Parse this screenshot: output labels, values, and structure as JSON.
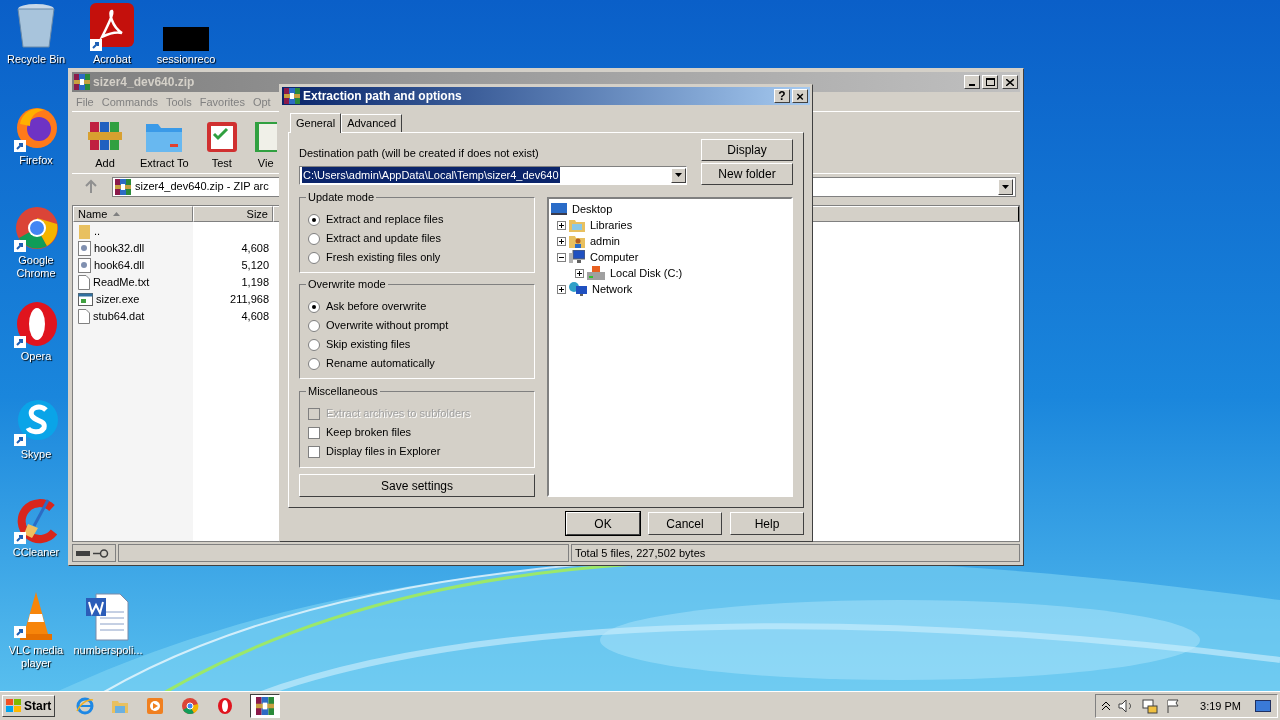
{
  "desktop_icons": [
    {
      "label": "Recycle Bin",
      "kind": "recycle"
    },
    {
      "label": "Acrobat",
      "kind": "acrobat"
    },
    {
      "label": "sessionreco",
      "kind": "redacted"
    },
    {
      "label": "Firefox",
      "kind": "firefox"
    },
    {
      "label": "Google Chrome",
      "kind": "chrome"
    },
    {
      "label": "Opera",
      "kind": "opera"
    },
    {
      "label": "Skype",
      "kind": "skype"
    },
    {
      "label": "CCleaner",
      "kind": "ccleaner"
    },
    {
      "label": "VLC media player",
      "kind": "vlc"
    },
    {
      "label": "numberspoli...",
      "kind": "word"
    }
  ],
  "archive_window": {
    "title": "sizer4_dev640.zip",
    "menu": [
      "File",
      "Commands",
      "Tools",
      "Favorites",
      "Opt"
    ],
    "toolbar": [
      {
        "label": "Add",
        "kind": "add"
      },
      {
        "label": "Extract To",
        "kind": "extract"
      },
      {
        "label": "Test",
        "kind": "test"
      },
      {
        "label": "Vie",
        "kind": "view"
      }
    ],
    "address": "sizer4_dev640.zip - ZIP arc",
    "columns": [
      "Name",
      "Size"
    ],
    "files": [
      {
        "name": "..",
        "kind": "folder"
      },
      {
        "name": "hook32.dll",
        "size": "4,608",
        "kind": "dll"
      },
      {
        "name": "hook64.dll",
        "size": "5,120",
        "kind": "dll"
      },
      {
        "name": "ReadMe.txt",
        "size": "1,198",
        "kind": "file"
      },
      {
        "name": "sizer.exe",
        "size": "211,968",
        "kind": "exe"
      },
      {
        "name": "stub64.dat",
        "size": "4,608",
        "kind": "file"
      }
    ],
    "status": "Total 5 files, 227,502 bytes"
  },
  "dialog": {
    "title": "Extraction path and options",
    "help_button": "?",
    "close_button": "×",
    "tabs": [
      {
        "label": "General",
        "selected": true
      },
      {
        "label": "Advanced",
        "selected": false
      }
    ],
    "destination_label": "Destination path (will be created if does not exist)",
    "destination_path": "C:\\Users\\admin\\AppData\\Local\\Temp\\sizer4_dev640",
    "side_buttons": [
      "Display",
      "New folder"
    ],
    "update_mode": {
      "title": "Update mode",
      "options": [
        {
          "label": "Extract and replace files",
          "selected": true
        },
        {
          "label": "Extract and update files",
          "selected": false
        },
        {
          "label": "Fresh existing files only",
          "selected": false
        }
      ]
    },
    "overwrite_mode": {
      "title": "Overwrite mode",
      "options": [
        {
          "label": "Ask before overwrite",
          "selected": true
        },
        {
          "label": "Overwrite without prompt",
          "selected": false
        },
        {
          "label": "Skip existing files",
          "selected": false
        },
        {
          "label": "Rename automatically",
          "selected": false
        }
      ]
    },
    "miscellaneous": {
      "title": "Miscellaneous",
      "options": [
        {
          "label": "Extract archives to subfolders",
          "checked": false,
          "disabled": true
        },
        {
          "label": "Keep broken files",
          "checked": false,
          "disabled": false
        },
        {
          "label": "Display files in Explorer",
          "checked": false,
          "disabled": false
        }
      ]
    },
    "save_button": "Save settings",
    "tree": [
      {
        "label": "Desktop",
        "kind": "desktop",
        "children": [
          {
            "label": "Libraries",
            "kind": "libraries",
            "expanded": false
          },
          {
            "label": "admin",
            "kind": "user",
            "expanded": false
          },
          {
            "label": "Computer",
            "kind": "computer",
            "expanded": true,
            "children": [
              {
                "label": "Local Disk (C:)",
                "kind": "disk",
                "expanded": false
              }
            ]
          },
          {
            "label": "Network",
            "kind": "network",
            "expanded": false
          }
        ]
      }
    ],
    "footer_buttons": [
      {
        "label": "OK",
        "selected": true
      },
      {
        "label": "Cancel",
        "selected": false
      },
      {
        "label": "Help",
        "selected": false
      }
    ]
  },
  "taskbar": {
    "start": "Start",
    "apps": [
      {
        "kind": "ie",
        "selected": false
      },
      {
        "kind": "explorer",
        "selected": false
      },
      {
        "kind": "media",
        "selected": false
      },
      {
        "kind": "chrome",
        "selected": false
      },
      {
        "kind": "opera",
        "selected": false
      },
      {
        "kind": "winrar",
        "selected": true
      }
    ],
    "clock": "3:19 PM"
  }
}
